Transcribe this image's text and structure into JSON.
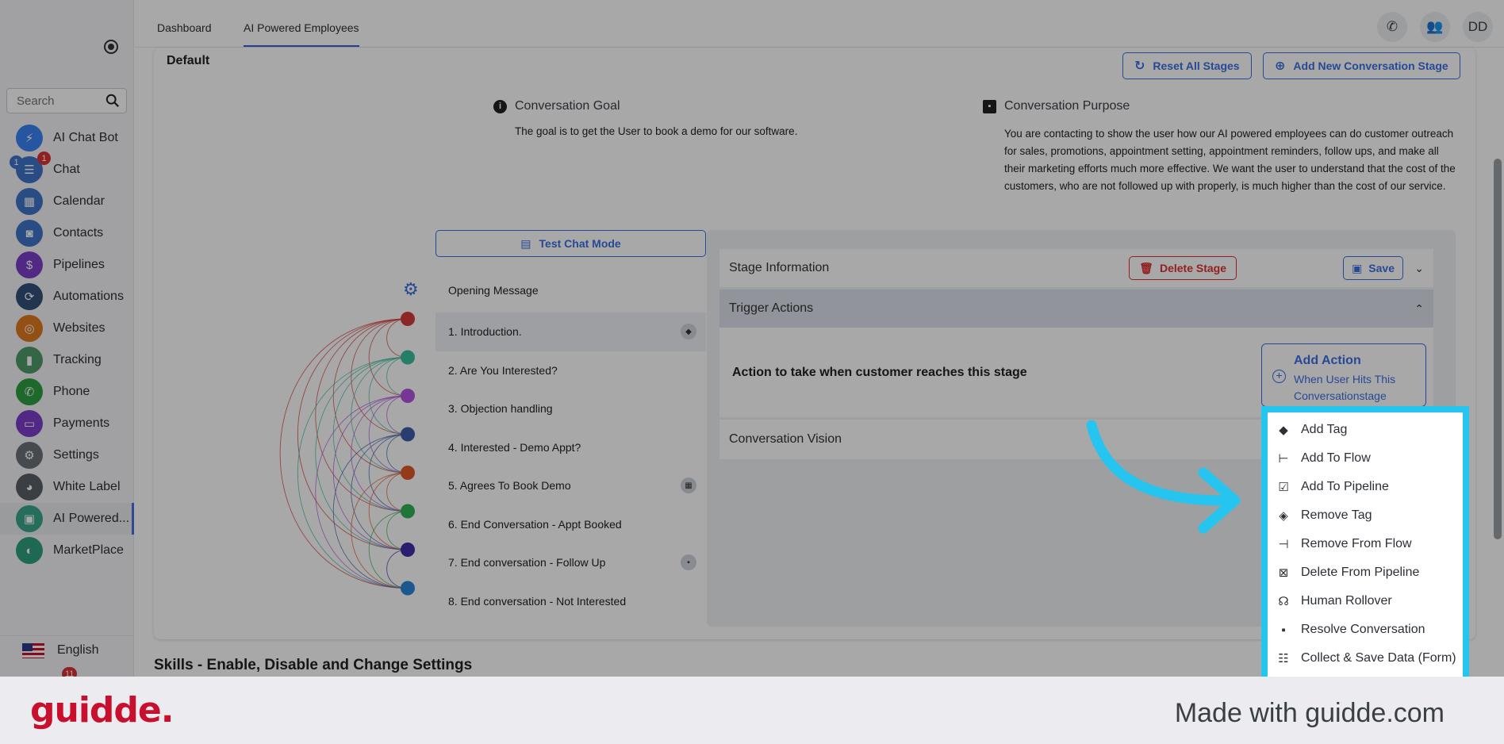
{
  "sidebar": {
    "search_placeholder": "Search",
    "items": [
      {
        "label": "AI Chat Bot",
        "icon": "bolt-icon",
        "color": "#3b82f6"
      },
      {
        "label": "Chat",
        "icon": "chat-icon",
        "color": "#3f74c9",
        "badge_left": "1",
        "badge_right": "1"
      },
      {
        "label": "Calendar",
        "icon": "calendar-icon",
        "color": "#3f74c9"
      },
      {
        "label": "Contacts",
        "icon": "contacts-icon",
        "color": "#3f74c9"
      },
      {
        "label": "Pipelines",
        "icon": "dollar-icon",
        "color": "#7b3fc9"
      },
      {
        "label": "Automations",
        "icon": "automation-icon",
        "color": "#33507a"
      },
      {
        "label": "Websites",
        "icon": "globe-icon",
        "color": "#e07a1f"
      },
      {
        "label": "Tracking",
        "icon": "chart-icon",
        "color": "#4f9a6a"
      },
      {
        "label": "Phone",
        "icon": "phone-icon",
        "color": "#2f9e44"
      },
      {
        "label": "Payments",
        "icon": "card-icon",
        "color": "#7b3fc9"
      },
      {
        "label": "Settings",
        "icon": "gear-icon",
        "color": "#6b6f76"
      },
      {
        "label": "White Label",
        "icon": "palette-icon",
        "color": "#5a5e66"
      },
      {
        "label": "AI Powered...",
        "icon": "ai-chat-icon",
        "color": "#3aa68b"
      },
      {
        "label": "MarketPlace",
        "icon": "marketplace-icon",
        "color": "#2f9e7e"
      }
    ],
    "language": "English",
    "bottom_badge": "11"
  },
  "topbar": {
    "tabs": [
      "Dashboard",
      "AI Powered Employees"
    ],
    "avatar": "DD"
  },
  "main": {
    "title": "Default",
    "reset_button": "Reset All Stages",
    "add_stage_button": "Add New Conversation Stage",
    "goal_label": "Conversation Goal",
    "goal_text": "The goal is to get the User to book a demo for our software.",
    "purpose_label": "Conversation Purpose",
    "purpose_text": "You are contacting to show the user how our AI powered employees can do customer outreach for sales, promotions, appointment setting, appointment reminders, follow ups, and make all their marketing efforts much more effective. We want the user to understand that the cost of the customers, who are not followed up with properly, is much higher than the cost of our service.",
    "test_chat_button": "Test Chat Mode",
    "opening_message": "Opening Message",
    "stages": [
      {
        "label": "1. Introduction.",
        "color": "#d63b3b",
        "badge": "tag"
      },
      {
        "label": "2. Are You Interested?",
        "color": "#3bbf9b"
      },
      {
        "label": "3. Objection handling",
        "color": "#b453e0"
      },
      {
        "label": "4. Interested - Demo Appt?",
        "color": "#3f5ea8"
      },
      {
        "label": "5. Agrees To Book Demo",
        "color": "#e0582a",
        "badge": "calendar"
      },
      {
        "label": "6. End Conversation - Appt Booked",
        "color": "#2fb457"
      },
      {
        "label": "7. End conversation - Follow Up",
        "color": "#3f2fa8",
        "badge": "chat"
      },
      {
        "label": "8. End conversation - Not Interested",
        "color": "#2a86d6"
      }
    ],
    "stage_information": "Stage Information",
    "delete_stage": "Delete Stage",
    "save": "Save",
    "trigger_actions": "Trigger Actions",
    "action_desc": "Action to take when customer reaches this stage",
    "add_action_title": "Add Action",
    "add_action_sub": "When User Hits This Conversationstage",
    "conversation_vision": "Conversation Vision",
    "skills_title": "Skills - Enable, Disable and Change Settings"
  },
  "dropdown": {
    "items": [
      {
        "label": "Add Tag",
        "icon": "tag-icon"
      },
      {
        "label": "Add To Flow",
        "icon": "flow-icon"
      },
      {
        "label": "Add To Pipeline",
        "icon": "clipboard-check-icon"
      },
      {
        "label": "Remove Tag",
        "icon": "tag-off-icon"
      },
      {
        "label": "Remove From Flow",
        "icon": "flow-remove-icon"
      },
      {
        "label": "Delete From Pipeline",
        "icon": "calendar-x-icon"
      },
      {
        "label": "Human Rollover",
        "icon": "headset-icon"
      },
      {
        "label": "Resolve Conversation",
        "icon": "message-icon"
      },
      {
        "label": "Collect & Save Data (Form)",
        "icon": "form-icon"
      }
    ]
  },
  "colors": {
    "accent": "#3c6fe3",
    "highlight": "#25c5ef",
    "danger": "#e03131"
  },
  "footer": {
    "logo": "guidde.",
    "made_with": "Made with guidde.com"
  }
}
